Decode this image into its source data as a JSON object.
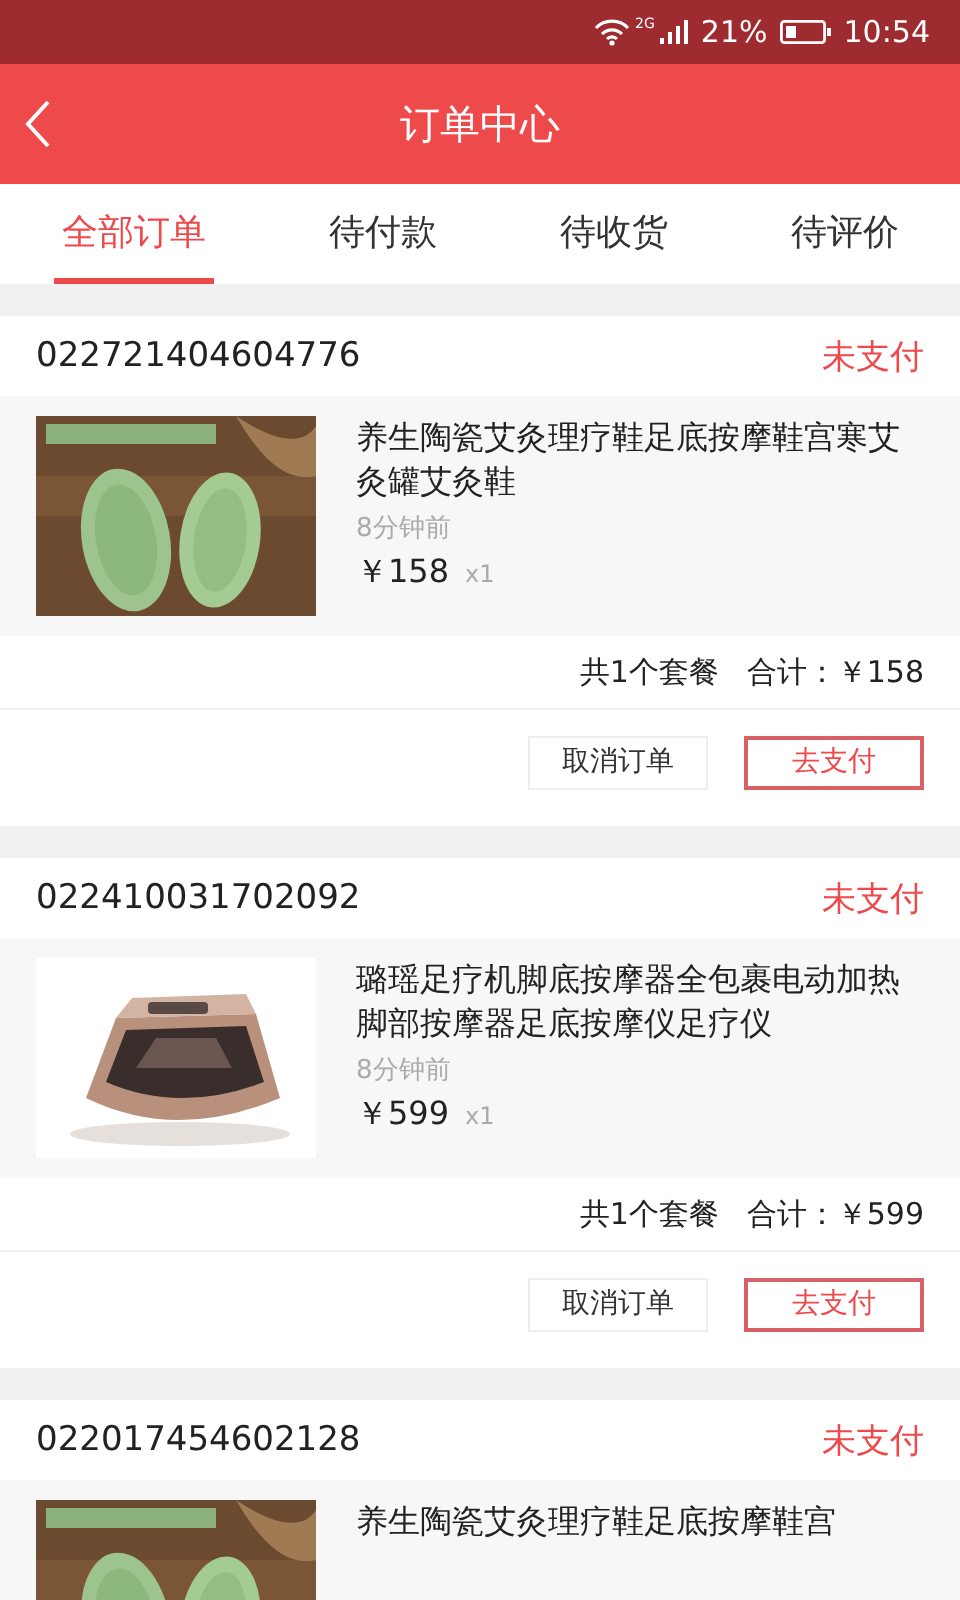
{
  "status_bar": {
    "signal_label": "2G",
    "battery": "21%",
    "time": "10:54"
  },
  "header": {
    "title": "订单中心"
  },
  "tabs": [
    {
      "label": "全部订单",
      "selected": true
    },
    {
      "label": "待付款",
      "selected": false
    },
    {
      "label": "待收货",
      "selected": false
    },
    {
      "label": "待评价",
      "selected": false
    }
  ],
  "orders": [
    {
      "number": "022721404604776",
      "status": "未支付",
      "product": {
        "title": "养生陶瓷艾灸理疗鞋足底按摩鞋宫寒艾灸罐艾灸鞋",
        "time": "8分钟前",
        "price": "￥158",
        "quantity": "x1"
      },
      "summary": {
        "count": "共1个套餐",
        "total": "合计：￥158"
      },
      "buttons": [
        "取消订单",
        "去支付"
      ]
    },
    {
      "number": "022410031702092",
      "status": "未支付",
      "product": {
        "title": "璐瑶足疗机脚底按摩器全包裹电动加热脚部按摩器足底按摩仪足疗仪",
        "time": "8分钟前",
        "price": "￥599",
        "quantity": "x1"
      },
      "summary": {
        "count": "共1个套餐",
        "total": "合计：￥599"
      },
      "buttons": [
        "取消订单",
        "去支付"
      ]
    },
    {
      "number": "022017454602128",
      "status": "未支付",
      "product": {
        "title": "养生陶瓷艾灸理疗鞋足底按摩鞋宫"
      }
    }
  ]
}
